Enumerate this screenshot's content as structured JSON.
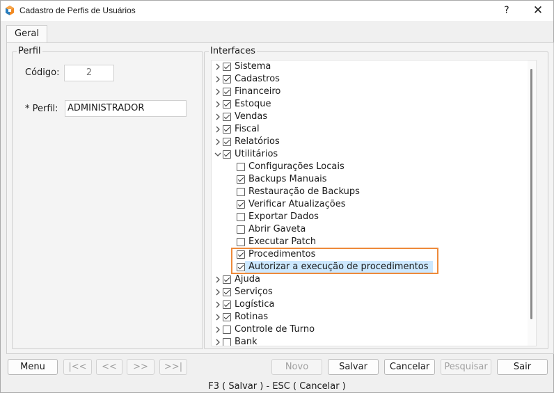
{
  "window": {
    "title": "Cadastro de Perfis de Usuários",
    "help_label": "?",
    "close_label": "✕"
  },
  "tabs": [
    {
      "label": "Geral",
      "active": true
    }
  ],
  "perfil": {
    "legend": "Perfil",
    "codigo_label": "Código:",
    "codigo_value": "2",
    "perfil_label": "* Perfil:",
    "perfil_value": "ADMINISTRADOR"
  },
  "interfaces": {
    "legend": "Interfaces",
    "items": [
      {
        "label": "Sistema",
        "checked": true,
        "expandable": true,
        "expanded": false,
        "level": 0
      },
      {
        "label": "Cadastros",
        "checked": true,
        "expandable": true,
        "expanded": false,
        "level": 0
      },
      {
        "label": "Financeiro",
        "checked": true,
        "expandable": true,
        "expanded": false,
        "level": 0
      },
      {
        "label": "Estoque",
        "checked": true,
        "expandable": true,
        "expanded": false,
        "level": 0
      },
      {
        "label": "Vendas",
        "checked": true,
        "expandable": true,
        "expanded": false,
        "level": 0
      },
      {
        "label": "Fiscal",
        "checked": true,
        "expandable": true,
        "expanded": false,
        "level": 0
      },
      {
        "label": "Relatórios",
        "checked": true,
        "expandable": true,
        "expanded": false,
        "level": 0
      },
      {
        "label": "Utilitários",
        "checked": true,
        "expandable": true,
        "expanded": true,
        "level": 0
      },
      {
        "label": "Configurações Locais",
        "checked": false,
        "expandable": false,
        "level": 1
      },
      {
        "label": "Backups Manuais",
        "checked": true,
        "expandable": false,
        "level": 1
      },
      {
        "label": "Restauração de Backups",
        "checked": false,
        "expandable": false,
        "level": 1
      },
      {
        "label": "Verificar Atualizações",
        "checked": true,
        "expandable": false,
        "level": 1
      },
      {
        "label": "Exportar Dados",
        "checked": false,
        "expandable": false,
        "level": 1
      },
      {
        "label": "Abrir Gaveta",
        "checked": false,
        "expandable": false,
        "level": 1
      },
      {
        "label": "Executar Patch",
        "checked": false,
        "expandable": false,
        "level": 1
      },
      {
        "label": "Procedimentos",
        "checked": true,
        "expandable": false,
        "level": 1
      },
      {
        "label": "Autorizar a execução de procedimentos",
        "checked": true,
        "expandable": false,
        "level": 1,
        "selected": true
      },
      {
        "label": "Ajuda",
        "checked": true,
        "expandable": true,
        "expanded": false,
        "level": 0
      },
      {
        "label": "Serviços",
        "checked": true,
        "expandable": true,
        "expanded": false,
        "level": 0
      },
      {
        "label": "Logística",
        "checked": true,
        "expandable": true,
        "expanded": false,
        "level": 0
      },
      {
        "label": "Rotinas",
        "checked": true,
        "expandable": true,
        "expanded": false,
        "level": 0
      },
      {
        "label": "Controle de Turno",
        "checked": false,
        "expandable": true,
        "expanded": false,
        "level": 0
      },
      {
        "label": "Bank",
        "checked": false,
        "expandable": true,
        "expanded": false,
        "level": 0
      }
    ]
  },
  "buttons": {
    "menu": "Menu",
    "first": "|<<",
    "prev": "<<",
    "next": ">>",
    "last": ">>|",
    "novo": "Novo",
    "salvar": "Salvar",
    "cancelar": "Cancelar",
    "pesquisar": "Pesquisar",
    "sair": "Sair"
  },
  "status": {
    "shortcuts": "F3 ( Salvar )  -  ESC ( Cancelar )"
  },
  "colors": {
    "highlight_box": "#ee8a3a",
    "selection": "#cce8ff"
  }
}
